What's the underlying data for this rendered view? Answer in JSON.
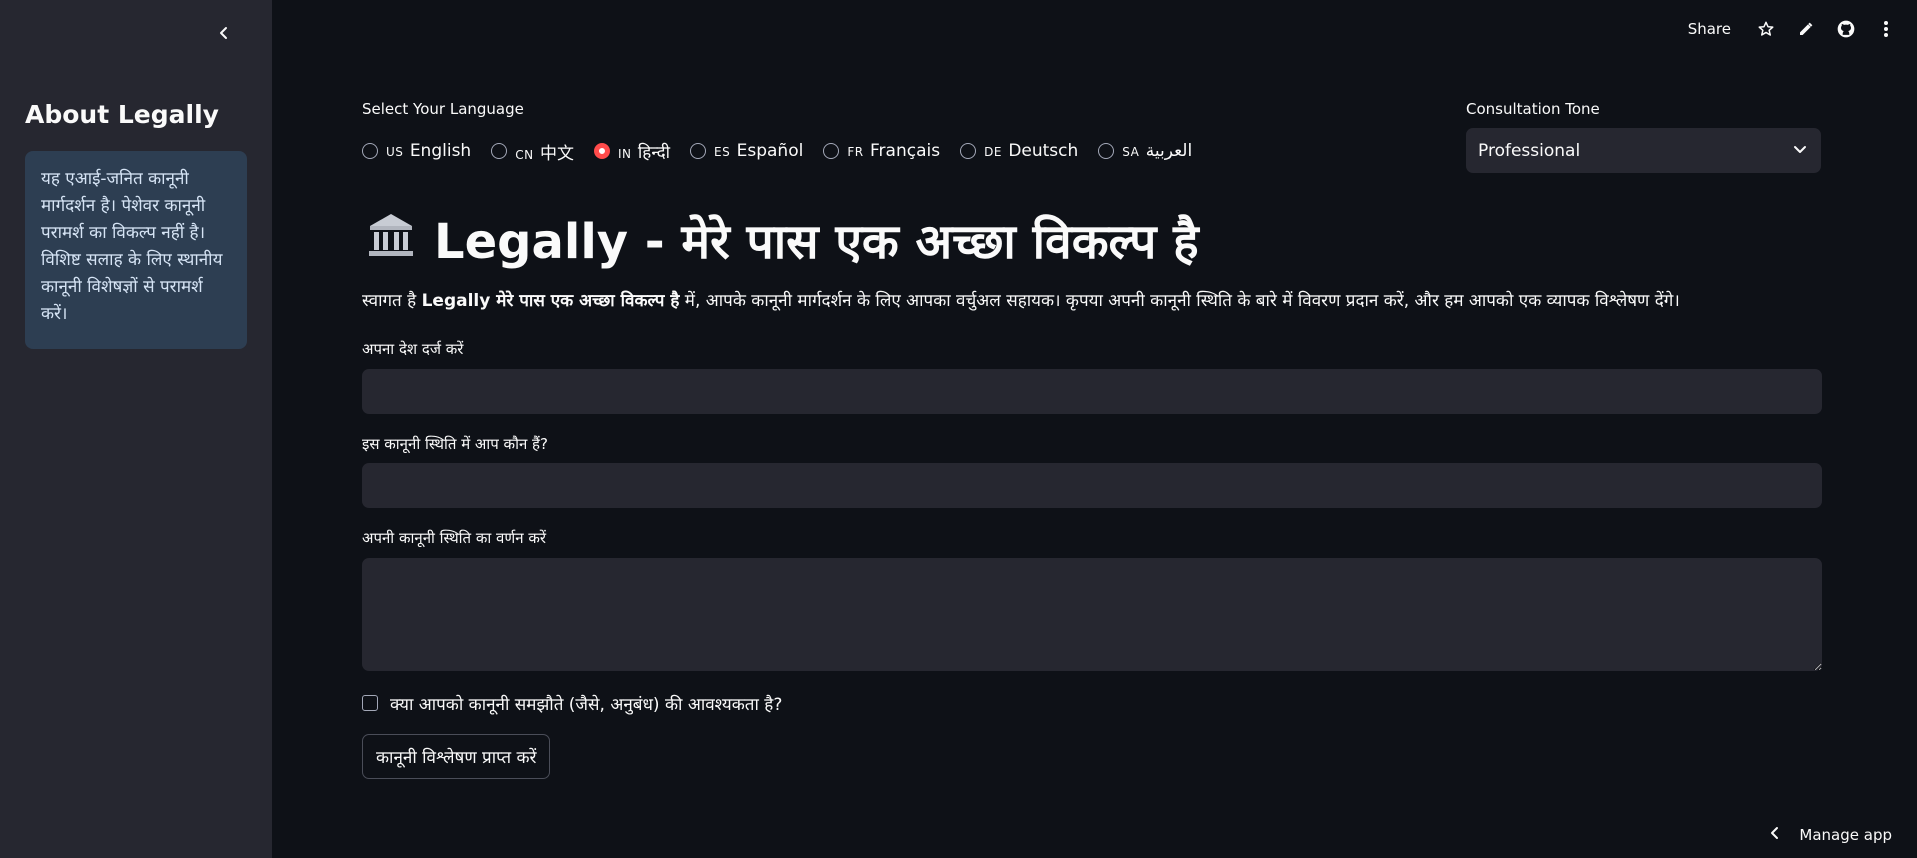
{
  "sidebar": {
    "collapse_icon": "chevron-left-icon",
    "title": "About Legally",
    "info": "यह एआई-जनित कानूनी मार्गदर्शन है। पेशेवर कानूनी परामर्श का विकल्प नहीं है। विशिष्ट सलाह के लिए स्थानीय कानूनी विशेषज्ञों से परामर्श करें।"
  },
  "toolbar": {
    "share_label": "Share",
    "icons": [
      "star-icon",
      "pencil-icon",
      "github-icon",
      "more-vertical-icon"
    ]
  },
  "language": {
    "label": "Select Your Language",
    "options": [
      {
        "flag": "US",
        "label": "English"
      },
      {
        "flag": "CN",
        "label": "中文"
      },
      {
        "flag": "IN",
        "label": "हिन्दी"
      },
      {
        "flag": "ES",
        "label": "Español"
      },
      {
        "flag": "FR",
        "label": "Français"
      },
      {
        "flag": "DE",
        "label": "Deutsch"
      },
      {
        "flag": "SA",
        "label": "العربية"
      }
    ],
    "selected_index": 2
  },
  "tone": {
    "label": "Consultation Tone",
    "selected": "Professional"
  },
  "header": {
    "icon": "🏛️",
    "title": "Legally - मेरे पास एक अच्छा विकल्प है"
  },
  "welcome": {
    "prefix": "स्वागत है ",
    "bold": "Legally मेरे पास एक अच्छा विकल्प है",
    "suffix": " में, आपके कानूनी मार्गदर्शन के लिए आपका वर्चुअल सहायक। कृपया अपनी कानूनी स्थिति के बारे में विवरण प्रदान करें, और हम आपको एक व्यापक विश्लेषण देंगे।"
  },
  "form": {
    "country_label": "अपना देश दर्ज करें",
    "country_value": "",
    "role_label": "इस कानूनी स्थिति में आप कौन हैं?",
    "role_value": "",
    "situation_label": "अपनी कानूनी स्थिति का वर्णन करें",
    "situation_value": "",
    "agreement_label": "क्या आपको कानूनी समझौते (जैसे, अनुबंध) की आवश्यकता है?",
    "agreement_checked": false,
    "submit_label": "कानूनी विश्लेषण प्राप्त करें"
  },
  "footer": {
    "manage_label": "Manage app"
  },
  "colors": {
    "background": "#0e1117",
    "sidebar": "#262730",
    "accent": "#ff4b4b",
    "info_box": "#2d3e52"
  }
}
